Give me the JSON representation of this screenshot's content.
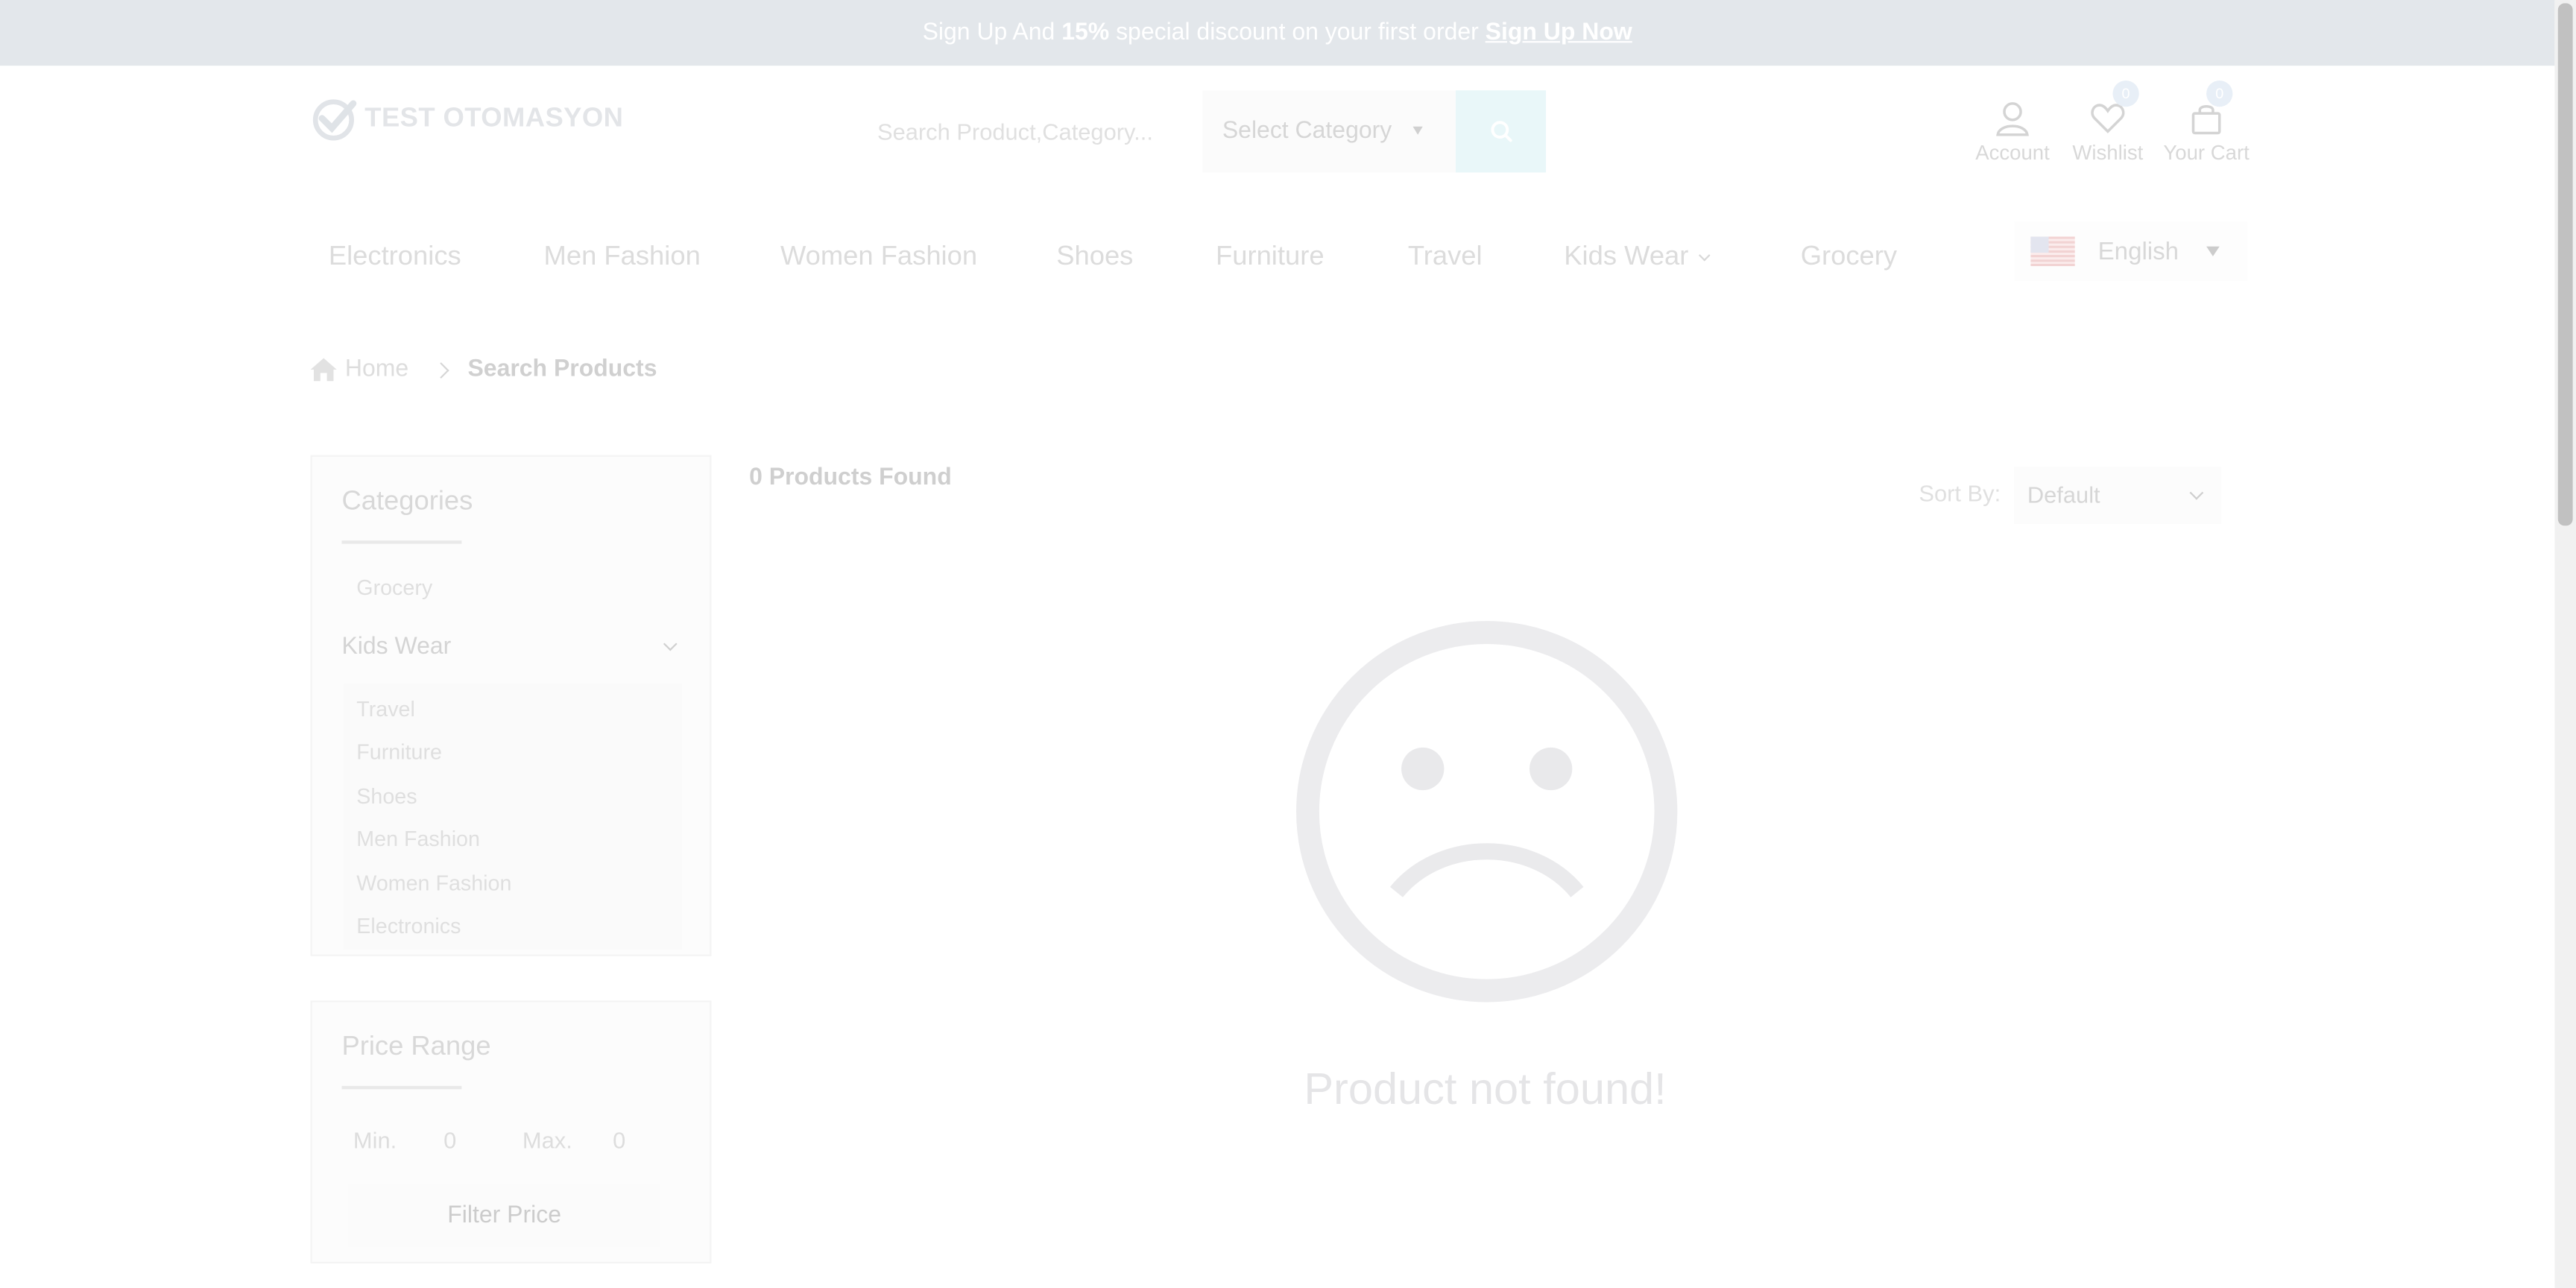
{
  "announcement": {
    "prefix": "Sign Up And",
    "discount": "15%",
    "suffix": "special discount on your first order",
    "link": "Sign Up Now"
  },
  "logo": {
    "text": "TEST OTOMASYON"
  },
  "search": {
    "placeholder": "Search Product,Category...",
    "category_label": "Select Category",
    "button_icon": "search-icon"
  },
  "header_icons": {
    "account": {
      "label": "Account",
      "icon": "user-icon"
    },
    "wishlist": {
      "label": "Wishlist",
      "icon": "heart-icon",
      "count": "0"
    },
    "cart": {
      "label": "Your Cart",
      "icon": "shopping-bag-icon",
      "count": "0"
    }
  },
  "nav": {
    "items": [
      "Electronics",
      "Men Fashion",
      "Women Fashion",
      "Shoes",
      "Furniture",
      "Travel",
      "Kids Wear",
      "Grocery"
    ]
  },
  "language": {
    "label": "English",
    "flag": "us-flag-icon"
  },
  "breadcrumb": {
    "home": "Home",
    "current": "Search Products"
  },
  "categories": {
    "title": "Categories",
    "items_top": [
      "Grocery"
    ],
    "parent": "Kids Wear",
    "items_sub": [
      "Travel",
      "Furniture",
      "Shoes",
      "Men Fashion",
      "Women Fashion",
      "Electronics"
    ]
  },
  "price_range": {
    "title": "Price Range",
    "min_label": "Min.",
    "min_value": "0",
    "max_label": "Max.",
    "max_value": "0",
    "button": "Filter Price"
  },
  "results": {
    "count_text": "0 Products Found",
    "sort_label": "Sort By:",
    "sort_value": "Default",
    "empty_message": "Product not found!",
    "empty_icon": "sad-face-icon"
  },
  "colors": {
    "announcement_bg": "#e3e7eb",
    "search_button_bg": "#e9f7f9",
    "badge_bg": "#e8eff7"
  }
}
